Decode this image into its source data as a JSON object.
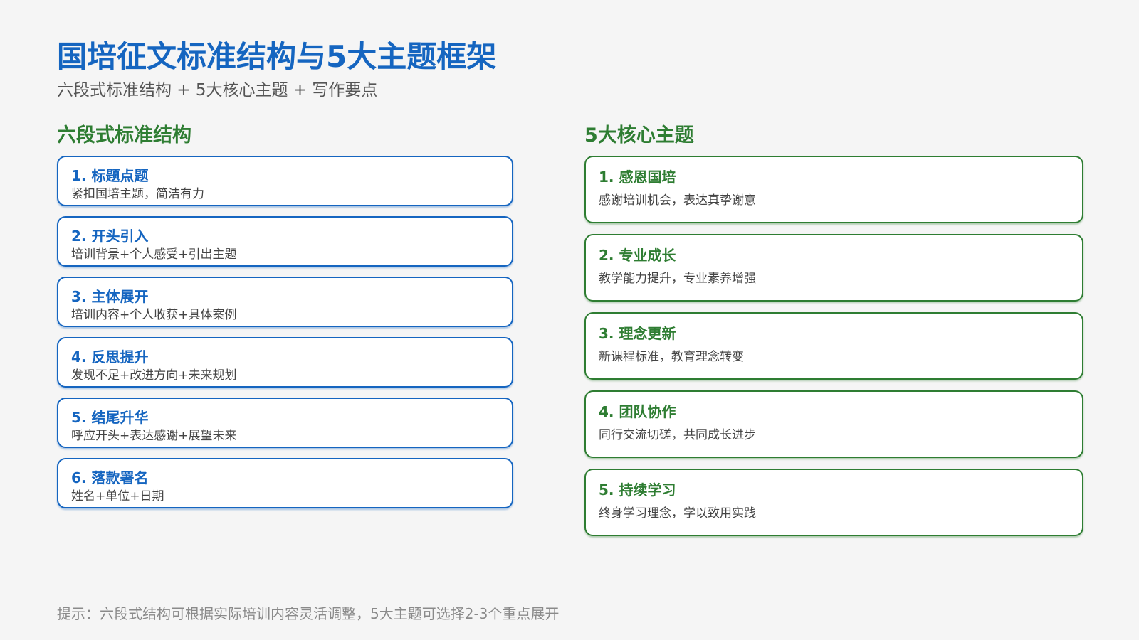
{
  "title": "国培征文标准结构与5大主题框架",
  "subtitle": "六段式标准结构 + 5大核心主题 + 写作要点",
  "structure": {
    "heading": "六段式标准结构",
    "items": [
      {
        "title": "1. 标题点题",
        "desc": "紧扣国培主题，简洁有力"
      },
      {
        "title": "2. 开头引入",
        "desc": "培训背景+个人感受+引出主题"
      },
      {
        "title": "3. 主体展开",
        "desc": "培训内容+个人收获+具体案例"
      },
      {
        "title": "4. 反思提升",
        "desc": "发现不足+改进方向+未来规划"
      },
      {
        "title": "5. 结尾升华",
        "desc": "呼应开头+表达感谢+展望未来"
      },
      {
        "title": "6. 落款署名",
        "desc": "姓名+单位+日期"
      }
    ]
  },
  "themes": {
    "heading": "5大核心主题",
    "items": [
      {
        "title": "1. 感恩国培",
        "desc": "感谢培训机会，表达真挚谢意"
      },
      {
        "title": "2. 专业成长",
        "desc": "教学能力提升，专业素养增强"
      },
      {
        "title": "3. 理念更新",
        "desc": "新课程标准，教育理念转变"
      },
      {
        "title": "4. 团队协作",
        "desc": "同行交流切磋，共同成长进步"
      },
      {
        "title": "5. 持续学习",
        "desc": "终身学习理念，学以致用实践"
      }
    ]
  },
  "tip": "提示：六段式结构可根据实际培训内容灵活调整，5大主题可选择2-3个重点展开",
  "colors": {
    "primary_blue": "#1565c0",
    "primary_green": "#2e7d32",
    "background": "#f5f5f5"
  }
}
